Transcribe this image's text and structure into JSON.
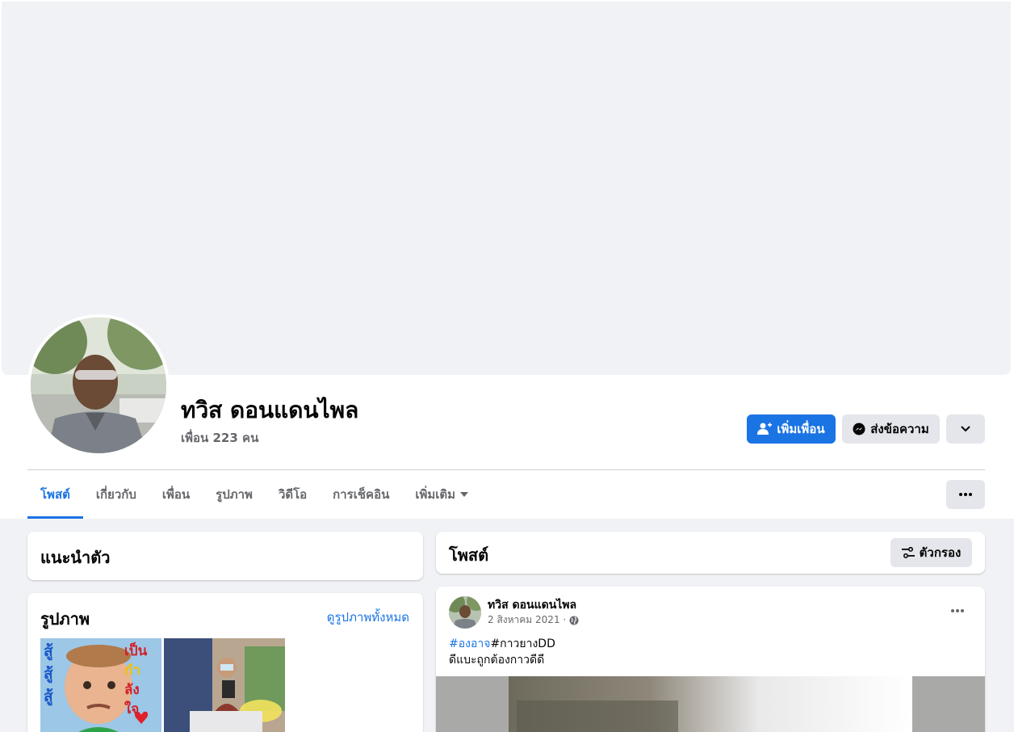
{
  "profile": {
    "name": "ทวิส ดอนแดนไพล",
    "friends": "เพื่อน 223 คน"
  },
  "actions": {
    "add_friend": "เพิ่มเพื่อน",
    "message": "ส่งข้อความ"
  },
  "tabs": [
    {
      "label": "โพสต์",
      "active": true
    },
    {
      "label": "เกี่ยวกับ"
    },
    {
      "label": "เพื่อน"
    },
    {
      "label": "รูปภาพ"
    },
    {
      "label": "วิดีโอ"
    },
    {
      "label": "การเช็คอิน"
    },
    {
      "label": "เพิ่มเติม"
    }
  ],
  "intro": {
    "title": "แนะนำตัว"
  },
  "photos": {
    "title": "รูปภาพ",
    "see_all": "ดูรูปภาพทั้งหมด",
    "thumb1_text": [
      "สู้",
      "สู้",
      "สู้",
      "เป็น",
      "กำ",
      "ลัง",
      "ใจ"
    ]
  },
  "posts": {
    "title": "โพสต์",
    "filter": "ตัวกรอง"
  },
  "post": {
    "author": "ทวิส ดอนแดนไพล",
    "date": "2 สิงหาคม 2021 ·",
    "hashtag": "#องอาจ",
    "tag2": "#กาวยางDD",
    "line2": "ดีแบะถูกต้องกาวดีดี"
  },
  "colors": {
    "accent": "#1b74e4",
    "background": "#f0f2f5",
    "button_gray": "#e4e6eb",
    "muted_text": "#65676b"
  }
}
